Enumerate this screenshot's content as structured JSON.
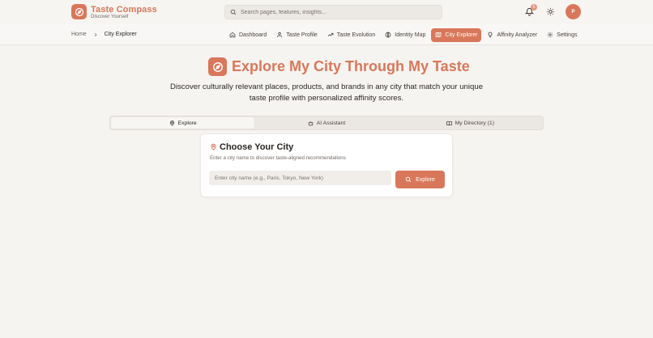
{
  "colors": {
    "accent": "#d9775a",
    "background": "#f6f4f1",
    "card": "#ffffff"
  },
  "brand": {
    "title": "Taste Compass",
    "subtitle": "Discover Yourself",
    "logo_icon": "compass-icon"
  },
  "search": {
    "placeholder": "Search pages, features, insights..."
  },
  "notifications": {
    "count": "5"
  },
  "user": {
    "initial": "P"
  },
  "breadcrumb": {
    "home": "Home",
    "current": "City Explorer"
  },
  "nav": {
    "items": [
      {
        "label": "Dashboard",
        "icon": "home-icon"
      },
      {
        "label": "Taste Profile",
        "icon": "user-icon"
      },
      {
        "label": "Taste Evolution",
        "icon": "trending-icon"
      },
      {
        "label": "Identity Map",
        "icon": "globe-icon"
      },
      {
        "label": "City Explorer",
        "icon": "map-icon",
        "active": true
      },
      {
        "label": "Affinity Analyzer",
        "icon": "lightbulb-icon"
      },
      {
        "label": "Settings",
        "icon": "gear-icon"
      }
    ]
  },
  "hero": {
    "title": "Explore My City Through My Taste",
    "description": "Discover culturally relevant places, products, and brands in any city that match your unique taste profile with personalized affinity scores."
  },
  "tabs": [
    {
      "label": "Explore",
      "icon": "pin-icon",
      "active": true
    },
    {
      "label": "AI Assistant",
      "icon": "bot-icon"
    },
    {
      "label": "My Directory (1)",
      "icon": "book-icon"
    }
  ],
  "city_card": {
    "title": "Choose Your City",
    "subtitle": "Enter a city name to discover taste-aligned recommendations",
    "input_placeholder": "Enter city name (e.g., Paris, Tokyo, New York)",
    "button_label": "Explore"
  }
}
